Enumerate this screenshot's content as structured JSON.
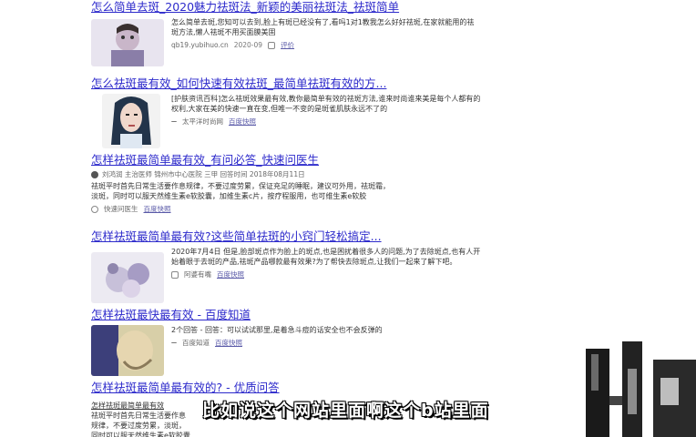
{
  "results": [
    {
      "title": "怎么简单去斑_2020魅力祛斑法_新颖的美丽祛斑法_祛斑简单",
      "snippet": "怎么简单去斑,您知可以去到,脸上有斑已经没有了,看吗1对1教我怎么好好祛斑,在家就能用的祛斑方法,懒人祛斑不用买面膜美固",
      "source": "qb19.yubihuo.cn",
      "date": "2020-09",
      "extra": "评价"
    },
    {
      "title": "怎么祛斑最有效_如何快速有效祛斑_最简单祛斑有效的方...",
      "snippet": "[护肤资讯百科]怎么祛斑效果最有效,教你最简单有效的祛斑方法,谁来时尚谁来美是每个人都有的权利,大家在美的快速一直在变,但唯一不变的是斑雀肌肤永远不了的",
      "source": "太平洋时尚网",
      "link": "百度快照"
    },
    {
      "title": "怎样祛斑最简单最有效_有问必答_快速问医生",
      "meta": "刘鸿润 主治医师 锦州市中心医院 三甲 回答时间 2018年08月11日",
      "snippet": "祛斑平时首先日常生活要作息规律，不要过度劳累，保证充足的睡眠，建议可外用，祛斑霜，淡斑，同时可以服天然维生素e软胶囊，加维生素c片，按疗程服用，也可维生素e软胶",
      "source": "快速问医生",
      "link": "百度快照"
    },
    {
      "title": "怎样祛斑最简单最有效?这些简单祛斑的小窍门轻松搞定...",
      "snippet": "2020年7月4日 但是,脸部斑点作为脸上的斑点,也是困扰着很多人的问题,为了去除斑点,也有人开始着眼于去斑的产品,祛斑产品哪款最有效果?为了帮快去除斑点,让我们一起来了解下吧。",
      "source": "阿婆有嘴",
      "link": "百度快照"
    },
    {
      "title": "怎样祛斑最快最有效 - 百度知道",
      "snippet": "2个回答 - 回答：可以试试那里,是着急斗痘的话安全也不会反弹的",
      "source": "百度知道",
      "link": "百度快照"
    },
    {
      "title": "怎样祛斑最简单最有效的? - 优质问答",
      "snippet_head": "怎样祛斑最简单最有效",
      "snippet": "祛斑平时首先日常生活要作息规律，不要过度劳累，淡斑，同时可以服天然维生素e软胶囊"
    }
  ],
  "subtitle": "比如说这个网站里面啊这个b站里面",
  "colors": {
    "link": "#2d2acb",
    "snippet": "#333333",
    "subtitle_fill": "#ffffff",
    "subtitle_outline": "#000000"
  },
  "icons": [
    "user-icon",
    "photo-icon",
    "hospital-icon",
    "source-icon"
  ]
}
